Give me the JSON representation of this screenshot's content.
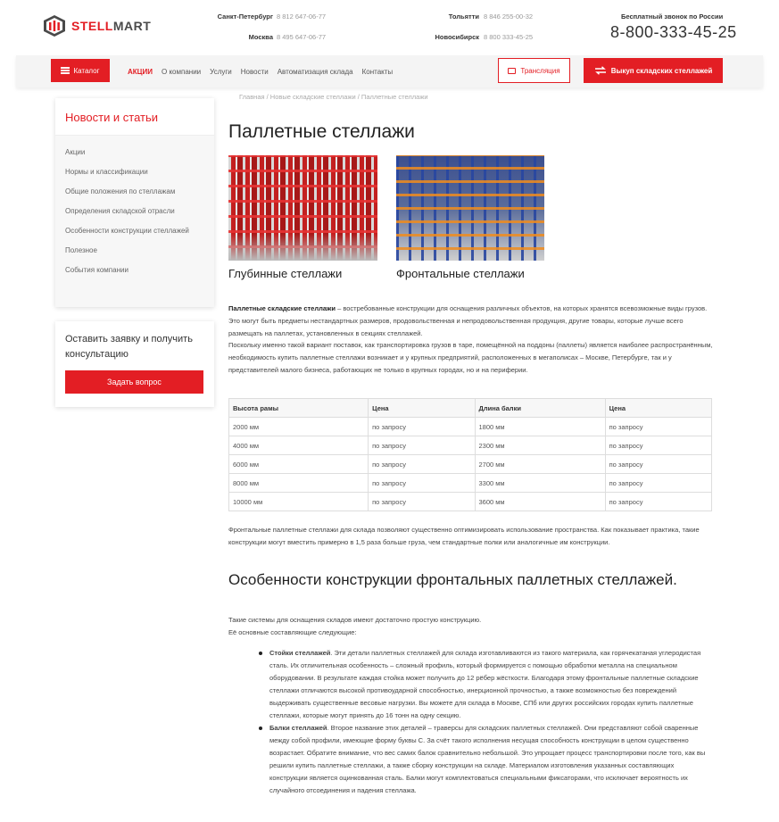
{
  "header": {
    "logo": {
      "part1": "STELL",
      "part2": "MART"
    },
    "contacts": [
      {
        "city": "Санкт-Петербург",
        "phone": "8 812 647-06-77"
      },
      {
        "city": "Москва",
        "phone": "8 495 647-06-77"
      },
      {
        "city": "Тольятти",
        "phone": "8 846 255-00-32"
      },
      {
        "city": "Новосибирск",
        "phone": "8 800 333-45-25"
      }
    ],
    "free_call_label": "Бесплатный звонок по России",
    "free_phone": "8-800-333-45-25"
  },
  "nav": {
    "catalog": "Каталог",
    "links": [
      "АКЦИИ",
      "О компании",
      "Услуги",
      "Новости",
      "Автоматизация склада",
      "Контакты"
    ],
    "stream": "Трансляция",
    "buyback": "Выкуп складских стеллажей"
  },
  "sidebar": {
    "title": "Новости и статьи",
    "items": [
      "Акции",
      "Нормы и классификации",
      "Общие положения по стеллажам",
      "Определения складской отрасли",
      "Особенности конструкции стеллажей",
      "Полезное",
      "События компании"
    ],
    "consult_text": "Оставить заявку и получить консультацию",
    "ask_button": "Задать вопрос"
  },
  "main": {
    "breadcrumb": "Главная / Новые складские стеллажи / Паллетные стеллажи",
    "title": "Паллетные стеллажи",
    "captions": [
      "Глубинные стеллажи",
      "Фронтальные стеллажи"
    ],
    "intro_bold": "Паллетные складские стеллажи",
    "intro_text": " – востребованные конструкции для оснащения различных объектов, на которых хранятся всевозможные виды грузов. Это могут быть предметы нестандартных размеров, продовольственная и непродовольственная продукция, другие товары, которые лучше всего размещать на паллетах, установленных в секциях стеллажей.",
    "intro_text2": "Поскольку именно такой вариант поставок, как транспортировка грузов в таре, помещённой на поддоны (паллеты) является наиболее распространённым, необходимость купить паллетные стеллажи возникает и у крупных предприятий, расположенных в мегаполисах – Москве, Петербурге, так и у представителей малого бизнеса, работающих не только в крупных городах, но и на периферии.",
    "table": {
      "headers": [
        "Высота рамы",
        "Цена",
        "Длина балки",
        "Цена"
      ],
      "rows": [
        [
          "2000 мм",
          "по запросу",
          "1800 мм",
          "по запросу"
        ],
        [
          "4000 мм",
          "по запросу",
          "2300 мм",
          "по запросу"
        ],
        [
          "6000 мм",
          "по запросу",
          "2700 мм",
          "по запросу"
        ],
        [
          "8000 мм",
          "по запросу",
          "3300 мм",
          "по запросу"
        ],
        [
          "10000 мм",
          "по запросу",
          "3600 мм",
          "по запросу"
        ]
      ]
    },
    "after_table": "Фронтальные паллетные стеллажи для склада позволяют существенно оптимизировать использование пространства. Как показывает практика, такие конструкции могут вместить примерно в 1,5 раза больше груза, чем стандартные полки или аналогичные им конструкции.",
    "h2": "Особенности конструкции фронтальных паллетных стеллажей.",
    "h2_text1": "Такие системы для оснащения складов имеют достаточно простую конструкцию.",
    "h2_text2": "Её основные составляющие следующие:",
    "bullets": [
      {
        "bold": "Стойки стеллажей",
        "text": ". Эти детали паллетных стеллажей для склада изготавливаются из такого материала, как горячекатаная углеродистая сталь. Их отличительная особенность – сложный профиль, который формируется с помощью обработки металла на специальном оборудовании. В результате каждая стойка может получить до 12 рёбер жёсткости. Благодаря этому фронтальные паллетные складские стеллажи отличаются высокой противоударной способностью, инерционной прочностью, а также возможностью без повреждений выдерживать существенные весовые нагрузки. Вы можете для склада в Москве, СПб или других российских городах купить паллетные стеллажи, которые могут принять до 16 тонн на одну секцию."
      },
      {
        "bold": "Балки стеллажей",
        "text": ". Второе название этих деталей – траверсы для складских паллетных стеллажей. Они представляют собой сваренные между собой профили, имеющие форму буквы С. За счёт такого исполнения несущая способность конструкции в целом существенно возрастает. Обратите внимание, что вес самих балок сравнительно небольшой. Это упрощает процесс транспортировки после того, как вы решили купить паллетные стеллажи, а также сборку конструкции на складе. Материалом изготовления указанных составляющих конструкции является оцинкованная сталь. Балки могут комплектоваться специальными фиксаторами, что исключает вероятность их случайного отсоединения и падения стеллажа."
      }
    ]
  },
  "colors": {
    "accent": "#e31e24",
    "text": "#333333",
    "muted": "#999999"
  }
}
